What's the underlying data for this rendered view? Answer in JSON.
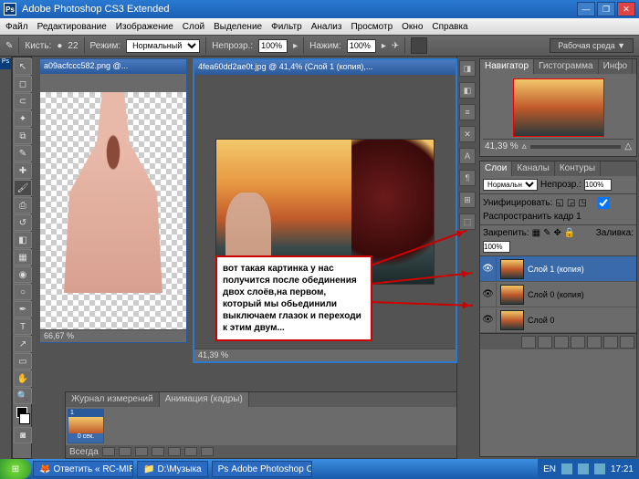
{
  "app": {
    "title": "Adobe Photoshop CS3 Extended",
    "logo": "Ps"
  },
  "menu": [
    "Файл",
    "Редактирование",
    "Изображение",
    "Слой",
    "Выделение",
    "Фильтр",
    "Анализ",
    "Просмотр",
    "Окно",
    "Справка"
  ],
  "options": {
    "brush_label": "Кисть:",
    "brush_size": "22",
    "mode_label": "Режим:",
    "mode_value": "Нормальный",
    "opacity_label": "Непрозр.:",
    "opacity_value": "100%",
    "flow_label": "Нажим:",
    "flow_value": "100%",
    "workspace": "Рабочая среда ▼"
  },
  "doc1": {
    "title": "a09acfccc582.png @...",
    "zoom": "66,67 %"
  },
  "doc2": {
    "title": "4fea60dd2ae0t.jpg @ 41,4% (Слой 1 (копия),...",
    "zoom": "41,39 %"
  },
  "nav": {
    "tabs": [
      "Навигатор",
      "Гистограмма",
      "Инфо"
    ],
    "zoom": "41,39 %"
  },
  "layers": {
    "tabs": [
      "Слои",
      "Каналы",
      "Контуры"
    ],
    "blend": "Нормальный",
    "opacity_label": "Непрозр.:",
    "opacity": "100%",
    "unify_label": "Унифицировать:",
    "propagate": "Распространить кадр 1",
    "lock_label": "Закрепить:",
    "fill_label": "Заливка:",
    "fill": "100%",
    "items": [
      {
        "name": "Слой 1 (копия)",
        "visible": true,
        "sel": true
      },
      {
        "name": "Слой 0 (копия)",
        "visible": true,
        "sel": false
      },
      {
        "name": "Слой 0",
        "visible": true,
        "sel": false
      }
    ]
  },
  "anim": {
    "tabs": [
      "Журнал измерений",
      "Анимация (кадры)"
    ],
    "frame_num": "1",
    "frame_time": "0 сек.",
    "loop": "Всегда"
  },
  "callout": "вот такая картинка у нас получится после обединения двох слоёв,на первом, который мы обьединили выключаем глазок и переходи  к этим двум...",
  "taskbar": {
    "items": [
      "Ответить « RC-MIR....",
      "D:\\Музыка",
      "Adobe Photoshop CS..."
    ],
    "lang": "EN",
    "time": "17:21"
  }
}
